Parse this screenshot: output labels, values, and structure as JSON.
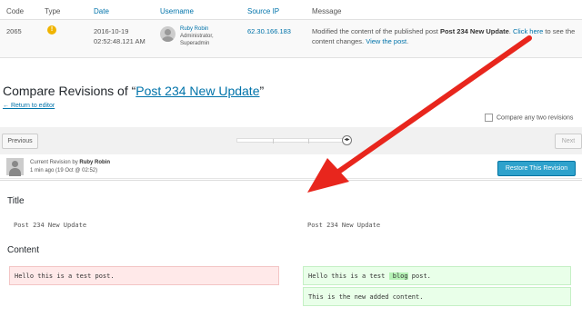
{
  "log": {
    "headers": {
      "code": "Code",
      "type": "Type",
      "date": "Date",
      "username": "Username",
      "source_ip": "Source IP",
      "message": "Message"
    },
    "row": {
      "code": "2065",
      "type_icon": "warning-icon",
      "type_symbol": "!",
      "date_line1": "2016-10-19",
      "date_line2": "02:52:48.121 AM",
      "user_name": "Ruby Robin",
      "user_role1": "Administrator,",
      "user_role2": "Superadmin",
      "ip": "62.30.166.183",
      "msg_prefix": "Modified the content of the published post ",
      "msg_post": "Post 234 New Update",
      "msg_mid": ". ",
      "msg_click_link": "Click here",
      "msg_suffix": " to see the content changes. ",
      "msg_view_link": "View the post",
      "msg_end": "."
    }
  },
  "compare": {
    "title_prefix": "Compare Revisions of “",
    "title_link": "Post 234 New Update",
    "title_suffix": "”",
    "return_link": "← Return to editor",
    "compare_two_label": "Compare any two revisions",
    "prev_label": "Previous",
    "next_label": "Next",
    "handle_symbol": "◂▸",
    "meta_line1_prefix": "Current Revision by ",
    "meta_author": "Ruby Robin",
    "meta_line2": "1 min ago (19 Oct @ 02:52)",
    "restore_label": "Restore This Revision"
  },
  "diff": {
    "title_heading": "Title",
    "title_old": "Post 234 New Update",
    "title_new": "Post 234 New Update",
    "content_heading": "Content",
    "content_old": "Hello this is a test post.",
    "content_new_before": "Hello this is a test ",
    "content_new_added": " blog",
    "content_new_after": " post.",
    "content_new_line2": "This is the new added content."
  },
  "colors": {
    "accent": "#0073aa",
    "arrow": "#e8261d",
    "deleted_bg": "#ffe9e9",
    "added_bg": "#e9ffe9",
    "restore_btn": "#2ea2cc"
  }
}
